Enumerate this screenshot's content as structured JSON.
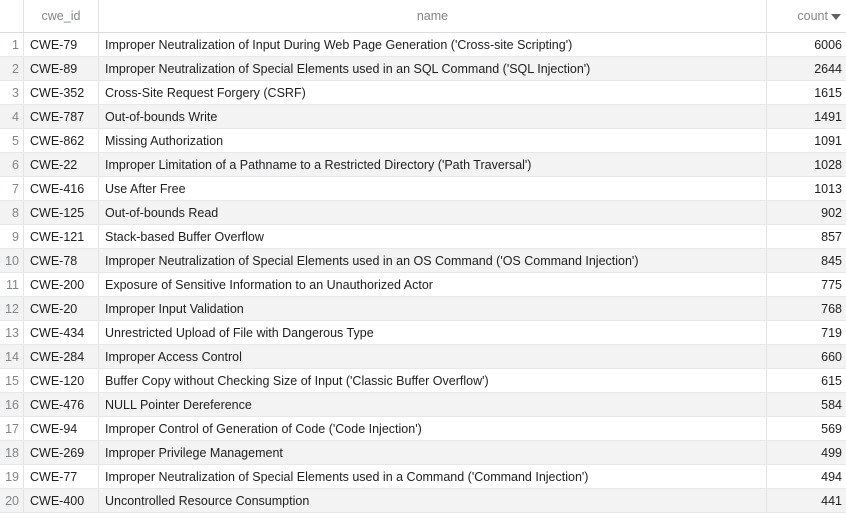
{
  "columns": {
    "rownum": "",
    "cwe_id": "cwe_id",
    "name": "name",
    "count": "count",
    "sort": {
      "column": "count",
      "direction": "descending",
      "icon": "sort-down-icon"
    }
  },
  "rows": [
    {
      "n": "1",
      "cwe_id": "CWE-79",
      "name": "Improper Neutralization of Input During Web Page Generation ('Cross-site Scripting')",
      "count": "6006"
    },
    {
      "n": "2",
      "cwe_id": "CWE-89",
      "name": "Improper Neutralization of Special Elements used in an SQL Command ('SQL Injection')",
      "count": "2644"
    },
    {
      "n": "3",
      "cwe_id": "CWE-352",
      "name": "Cross-Site Request Forgery (CSRF)",
      "count": "1615"
    },
    {
      "n": "4",
      "cwe_id": "CWE-787",
      "name": "Out-of-bounds Write",
      "count": "1491"
    },
    {
      "n": "5",
      "cwe_id": "CWE-862",
      "name": "Missing Authorization",
      "count": "1091"
    },
    {
      "n": "6",
      "cwe_id": "CWE-22",
      "name": "Improper Limitation of a Pathname to a Restricted Directory ('Path Traversal')",
      "count": "1028"
    },
    {
      "n": "7",
      "cwe_id": "CWE-416",
      "name": "Use After Free",
      "count": "1013"
    },
    {
      "n": "8",
      "cwe_id": "CWE-125",
      "name": "Out-of-bounds Read",
      "count": "902"
    },
    {
      "n": "9",
      "cwe_id": "CWE-121",
      "name": "Stack-based Buffer Overflow",
      "count": "857"
    },
    {
      "n": "10",
      "cwe_id": "CWE-78",
      "name": "Improper Neutralization of Special Elements used in an OS Command ('OS Command Injection')",
      "count": "845"
    },
    {
      "n": "11",
      "cwe_id": "CWE-200",
      "name": "Exposure of Sensitive Information to an Unauthorized Actor",
      "count": "775"
    },
    {
      "n": "12",
      "cwe_id": "CWE-20",
      "name": "Improper Input Validation",
      "count": "768"
    },
    {
      "n": "13",
      "cwe_id": "CWE-434",
      "name": "Unrestricted Upload of File with Dangerous Type",
      "count": "719"
    },
    {
      "n": "14",
      "cwe_id": "CWE-284",
      "name": "Improper Access Control",
      "count": "660"
    },
    {
      "n": "15",
      "cwe_id": "CWE-120",
      "name": "Buffer Copy without Checking Size of Input ('Classic Buffer Overflow')",
      "count": "615"
    },
    {
      "n": "16",
      "cwe_id": "CWE-476",
      "name": "NULL Pointer Dereference",
      "count": "584"
    },
    {
      "n": "17",
      "cwe_id": "CWE-94",
      "name": "Improper Control of Generation of Code ('Code Injection')",
      "count": "569"
    },
    {
      "n": "18",
      "cwe_id": "CWE-269",
      "name": "Improper Privilege Management",
      "count": "499"
    },
    {
      "n": "19",
      "cwe_id": "CWE-77",
      "name": "Improper Neutralization of Special Elements used in a Command ('Command Injection')",
      "count": "494"
    },
    {
      "n": "20",
      "cwe_id": "CWE-400",
      "name": "Uncontrolled Resource Consumption",
      "count": "441"
    }
  ]
}
